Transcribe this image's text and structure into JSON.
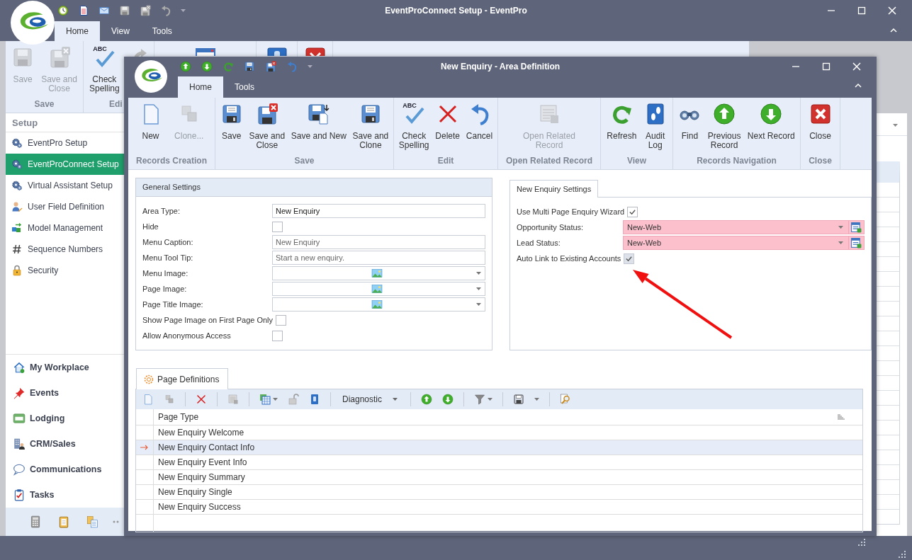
{
  "main_window": {
    "title": "EventProConnect Setup - EventPro",
    "tabs": [
      {
        "label": "Home",
        "selected": true
      },
      {
        "label": "View",
        "selected": false
      },
      {
        "label": "Tools",
        "selected": false
      }
    ],
    "ribbon_groups": [
      {
        "label": "Save",
        "buttons": [
          {
            "label": "Save",
            "disabled": true
          },
          {
            "label": "Save and\nClose",
            "disabled": true
          }
        ]
      },
      {
        "label": "Edi",
        "buttons": [
          {
            "label": "Check\nSpelling",
            "disabled": false,
            "icon_text": "ABC"
          }
        ]
      }
    ]
  },
  "sidebar": {
    "header": "Setup",
    "items": [
      {
        "label": "EventPro Setup",
        "selected": false
      },
      {
        "label": "EventProConnect Setup",
        "selected": true
      },
      {
        "label": "Virtual Assistant Setup",
        "selected": false
      },
      {
        "label": "User Field Definition",
        "selected": false
      },
      {
        "label": "Model Management",
        "selected": false
      },
      {
        "label": "Sequence Numbers",
        "selected": false
      },
      {
        "label": "Security",
        "selected": false
      }
    ],
    "nav": [
      "My Workplace",
      "Events",
      "Lodging",
      "CRM/Sales",
      "Communications",
      "Tasks"
    ]
  },
  "dialog": {
    "title": "New Enquiry - Area Definition",
    "tabs": [
      {
        "label": "Home",
        "selected": true
      },
      {
        "label": "Tools",
        "selected": false
      }
    ],
    "ribbon_groups": [
      {
        "label": "Records Creation",
        "buttons": [
          {
            "label": "New",
            "disabled": false
          },
          {
            "label": "Clone...",
            "disabled": true
          }
        ]
      },
      {
        "label": "Save",
        "buttons": [
          {
            "label": "Save",
            "disabled": false
          },
          {
            "label": "Save and\nClose",
            "disabled": false
          },
          {
            "label": "Save and New",
            "disabled": false
          },
          {
            "label": "Save and\nClone",
            "disabled": false
          }
        ]
      },
      {
        "label": "Edit",
        "buttons": [
          {
            "label": "Check\nSpelling",
            "disabled": false,
            "icon_text": "ABC"
          },
          {
            "label": "Delete",
            "disabled": false
          },
          {
            "label": "Cancel",
            "disabled": false
          }
        ]
      },
      {
        "label": "Open Related Record",
        "buttons": [
          {
            "label": "Open Related\nRecord",
            "disabled": true
          }
        ]
      },
      {
        "label": "View",
        "buttons": [
          {
            "label": "Refresh",
            "disabled": false
          },
          {
            "label": "Audit\nLog",
            "disabled": false
          }
        ]
      },
      {
        "label": "Records Navigation",
        "buttons": [
          {
            "label": "Find",
            "disabled": false
          },
          {
            "label": "Previous\nRecord",
            "disabled": false
          },
          {
            "label": "Next Record",
            "disabled": false
          }
        ]
      },
      {
        "label": "Close",
        "buttons": [
          {
            "label": "Close",
            "disabled": false
          }
        ]
      }
    ]
  },
  "general_settings": {
    "title": "General Settings",
    "fields": [
      {
        "kind": "text",
        "label": "Area Type:",
        "value": "New Enquiry"
      },
      {
        "kind": "checkbox",
        "label": "Hide",
        "checked": false,
        "disabled": false
      },
      {
        "kind": "text",
        "label": "Menu Caption:",
        "placeholder": "New Enquiry"
      },
      {
        "kind": "text",
        "label": "Menu Tool Tip:",
        "placeholder": "Start a new enquiry."
      },
      {
        "kind": "image",
        "label": "Menu Image:"
      },
      {
        "kind": "image",
        "label": "Page Image:"
      },
      {
        "kind": "image",
        "label": "Page Title Image:"
      },
      {
        "kind": "checkbox",
        "label": "Show Page Image on First Page Only",
        "checked": false,
        "disabled": false
      },
      {
        "kind": "checkbox",
        "label": "Allow Anonymous Access",
        "checked": false,
        "disabled": false
      }
    ]
  },
  "enquiry_settings": {
    "tab": "New Enquiry Settings",
    "fields": [
      {
        "kind": "checkbox",
        "label": "Use Multi Page Enquiry Wizard",
        "checked": true,
        "disabled": false
      },
      {
        "kind": "lookup",
        "label": "Opportunity Status:",
        "value": "New-Web",
        "required": true
      },
      {
        "kind": "lookup",
        "label": "Lead Status:",
        "value": "New-Web",
        "required": true
      },
      {
        "kind": "checkbox",
        "label": "Auto Link to Existing Accounts",
        "checked": true,
        "disabled": true
      }
    ]
  },
  "page_definitions": {
    "tab": "Page Definitions",
    "layout_dropdown": "Diagnostic",
    "columns": [
      "Page Type"
    ],
    "rows": [
      {
        "page_type": "New Enquiry Welcome",
        "selected": false
      },
      {
        "page_type": "New Enquiry Contact Info",
        "selected": true
      },
      {
        "page_type": "New Enquiry Event Info",
        "selected": false
      },
      {
        "page_type": "New Enquiry Summary",
        "selected": false
      },
      {
        "page_type": "New Enquiry Single",
        "selected": false
      },
      {
        "page_type": "New Enquiry Success",
        "selected": false
      }
    ]
  }
}
